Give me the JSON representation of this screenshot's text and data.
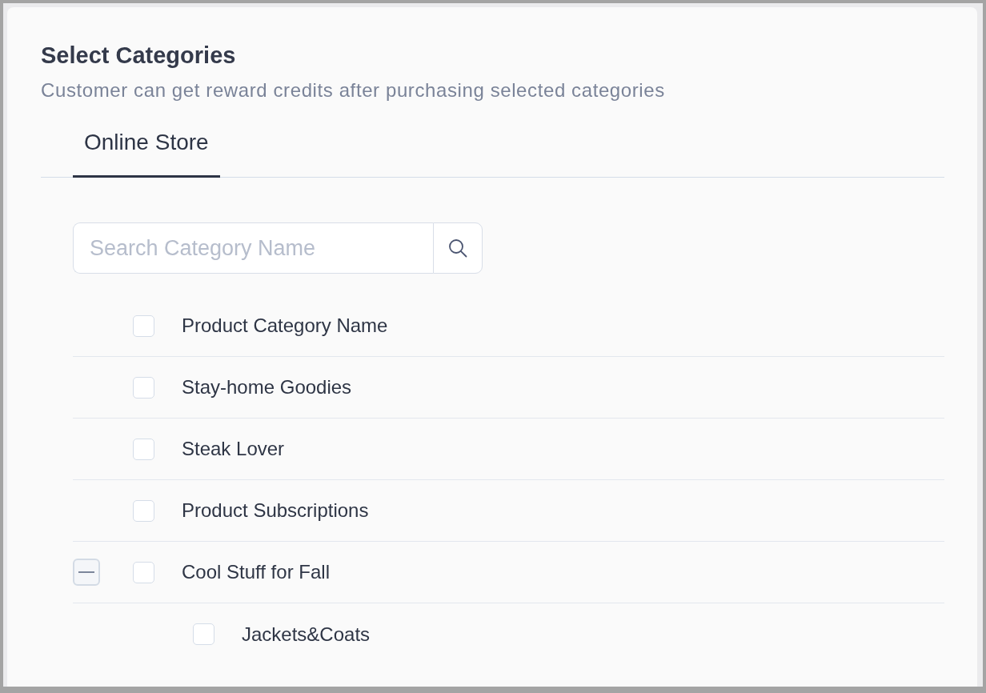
{
  "header": {
    "title": "Select Categories",
    "subtitle": "Customer can get reward credits after purchasing selected categories"
  },
  "tabs": [
    {
      "label": "Online Store",
      "selected": true
    }
  ],
  "search": {
    "placeholder": "Search Category Name"
  },
  "categories": [
    {
      "name": "Product Category Name",
      "checked": false
    },
    {
      "name": "Stay-home Goodies",
      "checked": false
    },
    {
      "name": "Steak Lover",
      "checked": false
    },
    {
      "name": "Product Subscriptions",
      "checked": false
    },
    {
      "name": "Cool Stuff for Fall",
      "checked": false,
      "expanded": true,
      "children": [
        {
          "name": "Jackets&Coats",
          "checked": false
        }
      ]
    }
  ]
}
